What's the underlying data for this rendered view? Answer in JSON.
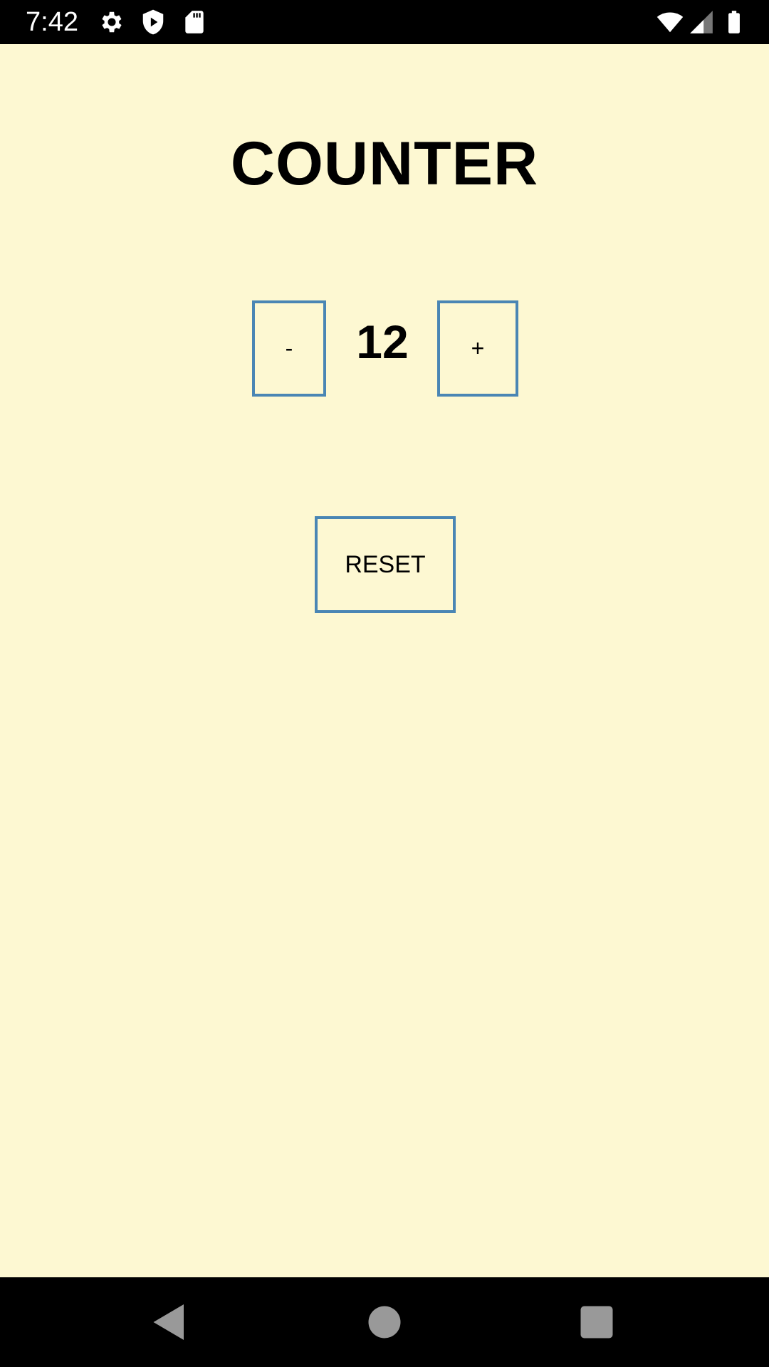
{
  "status_bar": {
    "time": "7:42",
    "icons": [
      "gear-icon",
      "shield-play-icon",
      "sd-card-icon",
      "wifi-icon",
      "signal-icon",
      "battery-icon"
    ]
  },
  "app": {
    "title": "COUNTER",
    "decrement_label": "-",
    "count": "12",
    "increment_label": "+",
    "reset_label": "RESET"
  },
  "nav_bar": {
    "icons": [
      "back-icon",
      "home-icon",
      "recents-icon"
    ]
  },
  "colors": {
    "background": "#fdf8d2",
    "button_border": "#4a86b4",
    "text": "#000000",
    "system_bars": "#000000"
  }
}
